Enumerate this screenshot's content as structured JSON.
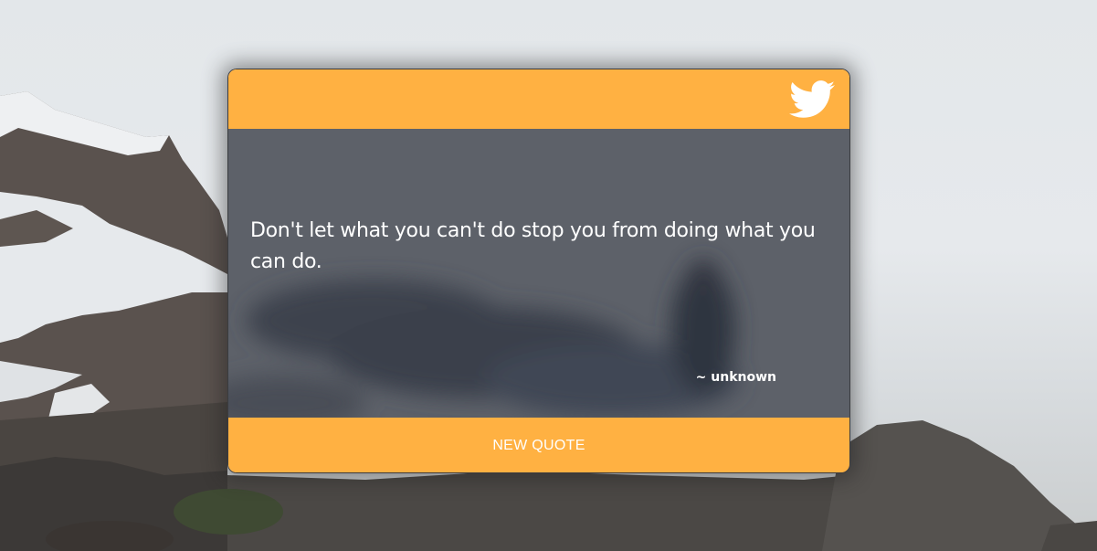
{
  "quote": {
    "text": "Don't let what you can't do stop you from doing what you can do.",
    "author": "~ unknown"
  },
  "actions": {
    "new_quote_label": "NEW QUOTE",
    "tweet_icon": "twitter-bird-icon"
  },
  "colors": {
    "accent": "#ffb142",
    "card_body": "#5d6169",
    "text": "#ffffff"
  }
}
